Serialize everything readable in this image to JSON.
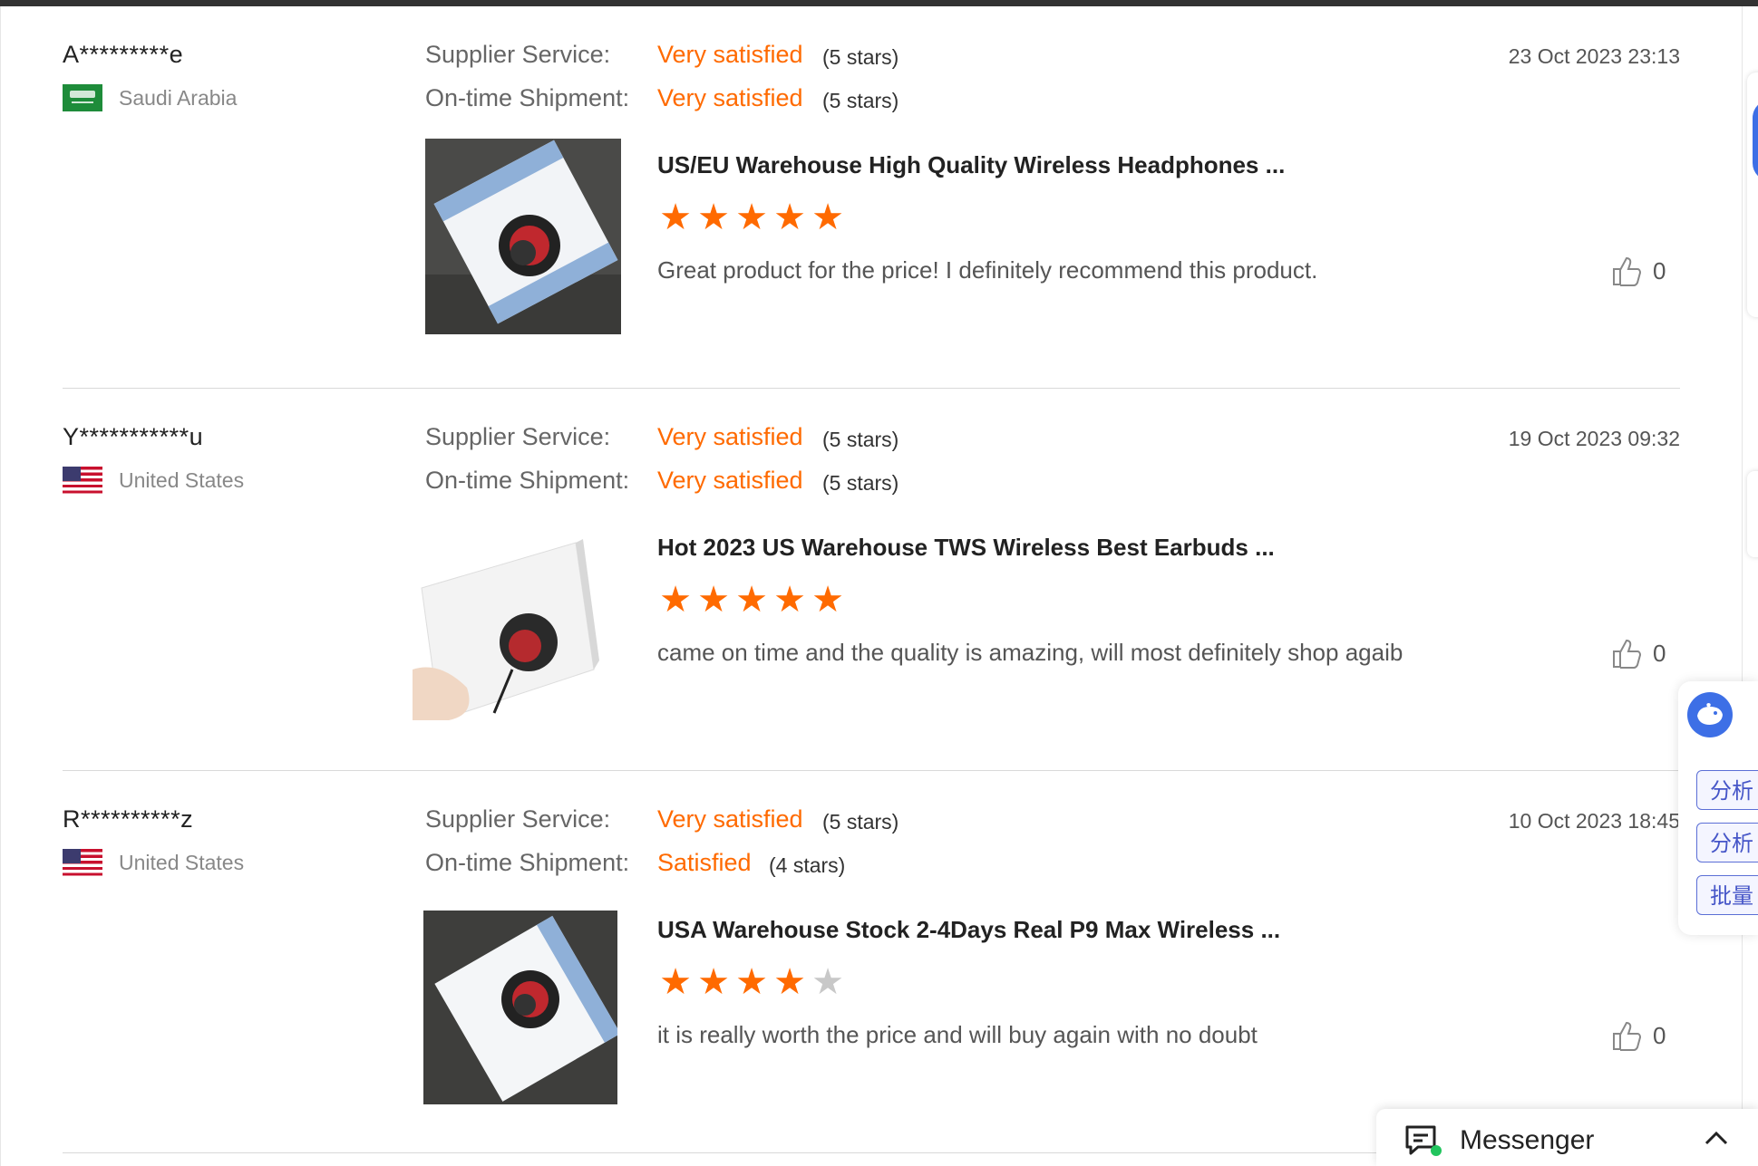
{
  "reviews": [
    {
      "buyer": "A*********e",
      "country": "Saudi Arabia",
      "date": "23 Oct 2023 23:13",
      "supplier_service_label": "Supplier Service:",
      "supplier_service_value": "Very satisfied",
      "supplier_service_stars": "(5 stars)",
      "shipment_label": "On-time Shipment:",
      "shipment_value": "Very satisfied",
      "shipment_stars": "(5 stars)",
      "product_title": "US/EU Warehouse High Quality Wireless Headphones ...",
      "rating": 5,
      "comment": "Great product for the price! I definitely recommend this product.",
      "likes": "0"
    },
    {
      "buyer": "Y***********u",
      "country": "United States",
      "date": "19 Oct 2023 09:32",
      "supplier_service_label": "Supplier Service:",
      "supplier_service_value": "Very satisfied",
      "supplier_service_stars": "(5 stars)",
      "shipment_label": "On-time Shipment:",
      "shipment_value": "Very satisfied",
      "shipment_stars": "(5 stars)",
      "product_title": "Hot 2023 US Warehouse TWS Wireless Best Earbuds ...",
      "rating": 5,
      "comment": "came on time and the quality is amazing, will most definitely shop agaib",
      "likes": "0"
    },
    {
      "buyer": "R**********z",
      "country": "United States",
      "date": "10 Oct 2023 18:45",
      "supplier_service_label": "Supplier Service:",
      "supplier_service_value": "Very satisfied",
      "supplier_service_stars": "(5 stars)",
      "shipment_label": "On-time Shipment:",
      "shipment_value": "Satisfied",
      "shipment_stars": "(4 stars)",
      "product_title": "USA Warehouse Stock 2-4Days Real P9 Max Wireless ...",
      "rating": 4,
      "comment": "it is really worth the price and will buy again with no doubt",
      "likes": "0"
    }
  ],
  "side_panel": {
    "buttons": [
      "分析",
      "分析",
      "批量"
    ],
    "icon": "whale-icon"
  },
  "messenger": {
    "label": "Messenger",
    "icon": "chat-icon"
  },
  "colors": {
    "accent": "#ff6a00",
    "star_empty": "#c8c8c8",
    "panel_blue": "#3d6fe6"
  }
}
